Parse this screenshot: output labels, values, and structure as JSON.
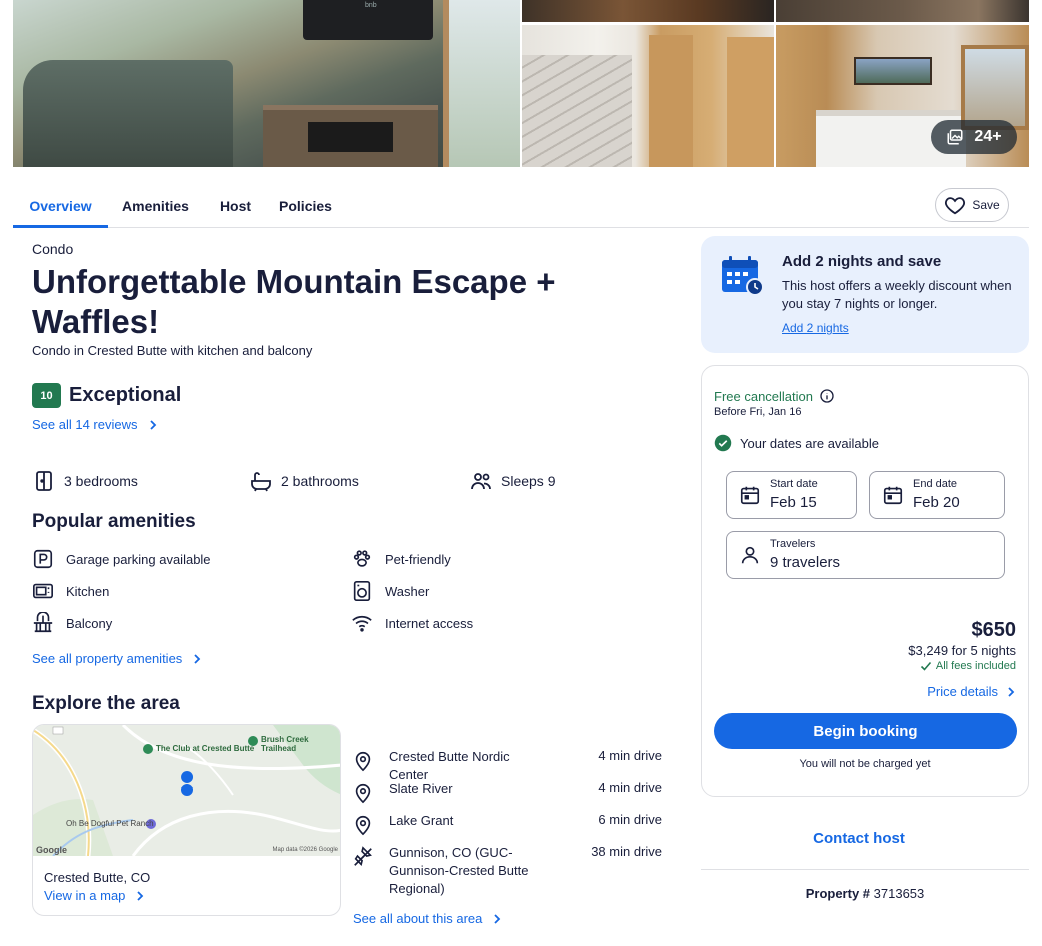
{
  "gallery": {
    "tv_logo_text": "bnb",
    "photo_count": "24+"
  },
  "tabs": [
    {
      "label": "Overview",
      "active": true
    },
    {
      "label": "Amenities",
      "active": false
    },
    {
      "label": "Host",
      "active": false
    },
    {
      "label": "Policies",
      "active": false
    }
  ],
  "save_label": "Save",
  "property": {
    "type": "Condo",
    "title": "Unforgettable Mountain Escape + Waffles!",
    "subtitle": "Condo in Crested Butte with kitchen and balcony",
    "rating_score": "10",
    "rating_label": "Exceptional",
    "reviews_link": "See all 14 reviews"
  },
  "facts": [
    {
      "icon": "bed-icon",
      "label": "3 bedrooms"
    },
    {
      "icon": "bathtub-icon",
      "label": "2 bathrooms"
    },
    {
      "icon": "people-icon",
      "label": "Sleeps 9"
    }
  ],
  "amenities": {
    "heading": "Popular amenities",
    "items": [
      {
        "icon": "parking-icon",
        "label": "Garage parking available"
      },
      {
        "icon": "paw-icon",
        "label": "Pet-friendly"
      },
      {
        "icon": "kitchen-icon",
        "label": "Kitchen"
      },
      {
        "icon": "washer-icon",
        "label": "Washer"
      },
      {
        "icon": "balcony-icon",
        "label": "Balcony"
      },
      {
        "icon": "wifi-icon",
        "label": "Internet access"
      }
    ],
    "see_all": "See all property amenities"
  },
  "area": {
    "heading": "Explore the area",
    "map": {
      "labels": [
        "Brush Creek Trailhead",
        "The Club at Crested Butte",
        "Oh Be Dogful Pet Ranch",
        "Google",
        "Map data ©2026 Google"
      ],
      "location": "Crested Butte, CO",
      "view_link": "View in a map"
    },
    "places": [
      {
        "icon": "pin-icon",
        "name": "Crested Butte Nordic Center",
        "distance": "4 min drive"
      },
      {
        "icon": "pin-icon",
        "name": "Slate River",
        "distance": "4 min drive"
      },
      {
        "icon": "pin-icon",
        "name": "Lake Grant",
        "distance": "6 min drive"
      },
      {
        "icon": "airplane-icon",
        "name": "Gunnison, CO (GUC-Gunnison-Crested Butte Regional)",
        "distance": "38 min drive"
      }
    ],
    "see_all": "See all about this area"
  },
  "promo": {
    "title": "Add 2 nights and save",
    "body": "This host offers a weekly discount when you stay 7 nights or longer.",
    "link": "Add 2 nights"
  },
  "booking": {
    "free_cancellation": "Free cancellation",
    "before": "Before Fri, Jan 16",
    "availability": "Your dates are available",
    "start_label": "Start date",
    "start_value": "Feb 15",
    "end_label": "End date",
    "end_value": "Feb 20",
    "travelers_label": "Travelers",
    "travelers_value": "9 travelers",
    "price": "$650",
    "total": "$3,249 for 5 nights",
    "fees": "All fees included",
    "price_details": "Price details",
    "begin": "Begin booking",
    "not_charged": "You will not be charged yet"
  },
  "contact_host": "Contact host",
  "property_number_label": "Property #",
  "property_number": "3713653",
  "colors": {
    "brand_blue": "#1668e3",
    "rating_green": "#227950",
    "text_dark": "#191e3b",
    "promo_bg": "#e8f0fd"
  }
}
